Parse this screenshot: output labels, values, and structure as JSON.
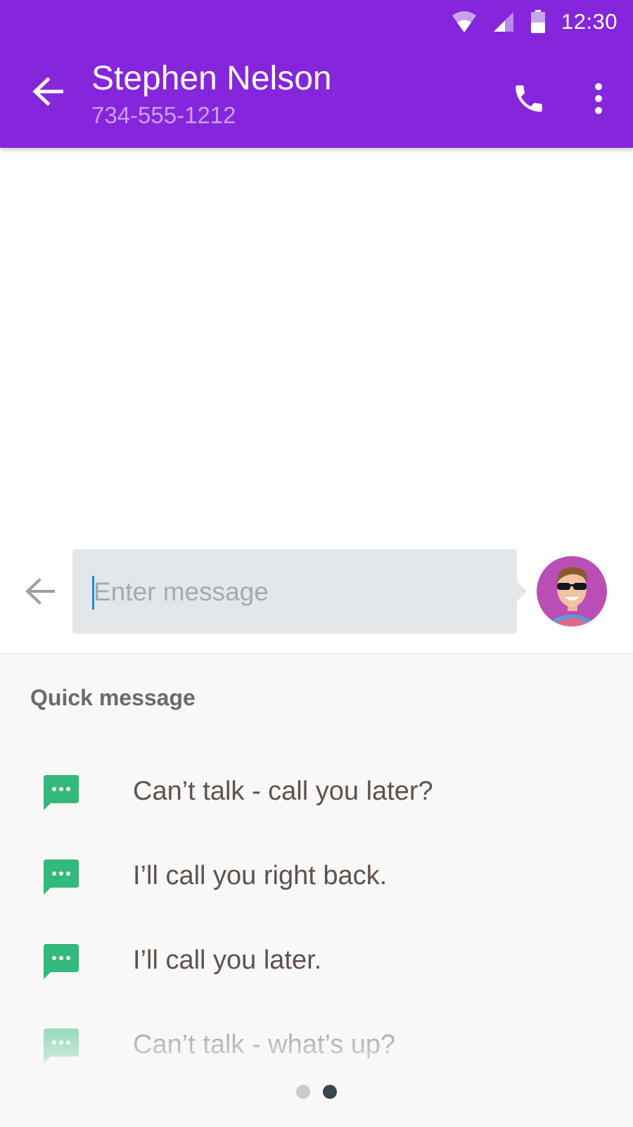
{
  "status_bar": {
    "time": "12:30",
    "icons": [
      "wifi-icon",
      "cell-signal-icon",
      "battery-icon"
    ]
  },
  "header": {
    "contact_name": "Stephen Nelson",
    "contact_phone": "734-555-1212",
    "icons": [
      "arrow-back-icon",
      "phone-icon",
      "more-vert-icon"
    ]
  },
  "compose": {
    "placeholder": "Enter message",
    "value": "",
    "icons": [
      "arrow-back-icon",
      "avatar"
    ]
  },
  "quick_messages": {
    "title": "Quick message",
    "items": [
      {
        "label": "Can’t talk - call you later?"
      },
      {
        "label": "I’ll call you right back."
      },
      {
        "label": "I’ll call you later."
      },
      {
        "label": "Can’t talk - what’s up?"
      }
    ],
    "icon": "message-bubble-icon",
    "pager": {
      "pages": 2,
      "active_page": 2
    }
  },
  "colors": {
    "header": "#8526dc",
    "phone_subtitle": "#c6a0f2",
    "compose_bg": "#e3e7e9",
    "caret": "#1e88e5",
    "bubble": "#33b97b",
    "sheet_bg": "#f8f8f8",
    "quick_text": "#5e524c",
    "dot_active": "#37474f",
    "dot_inactive": "#c9ccce"
  }
}
